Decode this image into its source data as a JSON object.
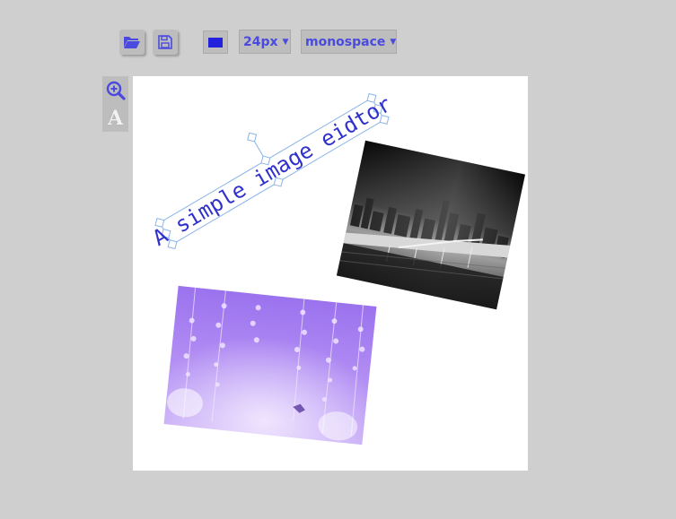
{
  "toolbar": {
    "open_icon": "folder-open-icon",
    "save_icon": "floppy-disk-icon",
    "current_color": "#2222dd",
    "font_size": "24px",
    "font_family": "monospace"
  },
  "side_tools": {
    "zoom_icon": "zoom-in-icon",
    "text_tool_glyph": "A"
  },
  "canvas": {
    "text_object": "A simple image eidtor",
    "text_color": "#3030cc",
    "selection_color": "#8ab4e8",
    "photo_city_description_icon": "city-bridge-photo",
    "photo_flowers_description_icon": "purple-wisteria-photo"
  }
}
